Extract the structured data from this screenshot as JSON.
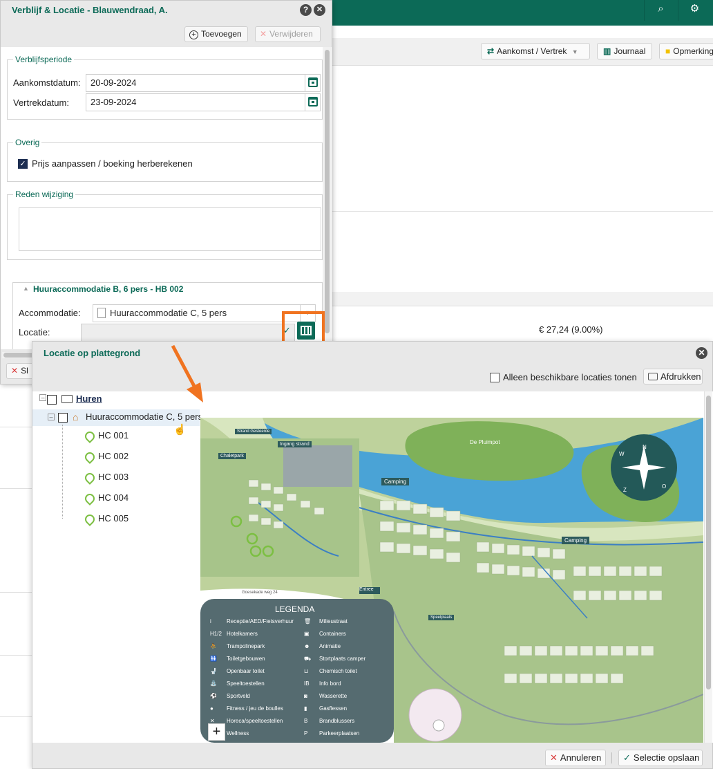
{
  "background": {
    "toolbar_buttons": [
      {
        "label": "Aankomst / Vertrek",
        "icon": "swap-arrows-icon"
      },
      {
        "label": "Journaal",
        "icon": "columns-icon"
      },
      {
        "label": "Opmerking",
        "icon": "comment-icon"
      }
    ],
    "price": "€ 27,24 (9.00%)",
    "close_button_partial": "Sl"
  },
  "dialog1": {
    "title": "Verblijf & Locatie - Blauwendraad, A.",
    "help_icon": "?",
    "add_label": "Toevoegen",
    "remove_label": "Verwijderen",
    "stay": {
      "legend": "Verblijfsperiode",
      "arrival_label": "Aankomstdatum:",
      "arrival_value": "20-09-2024",
      "departure_label": "Vertrekdatum:",
      "departure_value": "23-09-2024"
    },
    "other": {
      "legend": "Overig",
      "checkbox_label": "Prijs aanpassen / boeking herberekenen",
      "checked": true
    },
    "reason": {
      "legend": "Reden wijziging",
      "value": ""
    },
    "group": {
      "title": "Huuraccommodatie B, 6 pers - HB 002",
      "accommodation_label": "Accommodatie:",
      "accommodation_value": "Huuraccommodatie C, 5 pers",
      "location_label": "Locatie:",
      "location_value": ""
    }
  },
  "dialog2": {
    "title": "Locatie op plattegrond",
    "only_available_label": "Alleen beschikbare locaties tonen",
    "print_label": "Afdrukken",
    "tree": {
      "root": "Huren",
      "category": "Huuraccommodatie C, 5 pers",
      "items": [
        "HC 001",
        "HC 002",
        "HC 003",
        "HC 004",
        "HC 005"
      ]
    },
    "map": {
      "labels": {
        "strand": "Strand Gesteerde",
        "ingang_strand": "Ingang strand",
        "chaletpark": "Chaletpark",
        "camping1": "Camping",
        "camping2": "Camping",
        "pluimpot": "De Pluimpot",
        "entree": "Entree",
        "speelplaats": "Speelplaats",
        "road": "Goesekade weg 24"
      },
      "compass": [
        "N",
        "O",
        "Z",
        "W"
      ],
      "legend_title": "LEGENDA",
      "legend_left": [
        {
          "icon": "i",
          "text": "Receptie/AED/Fietsverhuur"
        },
        {
          "icon": "H1/2",
          "text": "Hotelkamers"
        },
        {
          "icon": "⛹",
          "text": "Trampolinepark"
        },
        {
          "icon": "🚻",
          "text": "Toiletgebouwen"
        },
        {
          "icon": "🚽",
          "text": "Openbaar toilet"
        },
        {
          "icon": "⛲",
          "text": "Speeltoestellen"
        },
        {
          "icon": "⚽",
          "text": "Sportveld"
        },
        {
          "icon": "●",
          "text": "Fitness / jeu de boulles"
        },
        {
          "icon": "✕",
          "text": "Horeca/speeltoestellen"
        },
        {
          "icon": "♨",
          "text": "Wellness"
        }
      ],
      "legend_right": [
        {
          "icon": "🗑",
          "text": "Milieustraat"
        },
        {
          "icon": "▣",
          "text": "Containers"
        },
        {
          "icon": "☻",
          "text": "Animatie"
        },
        {
          "icon": "⛟",
          "text": "Stortplaats camper"
        },
        {
          "icon": "⊔",
          "text": "Chemisch toilet"
        },
        {
          "icon": "IB",
          "text": "Info bord"
        },
        {
          "icon": "◙",
          "text": "Wasserette"
        },
        {
          "icon": "▮",
          "text": "Gasflessen"
        },
        {
          "icon": "B",
          "text": "Brandblussers"
        },
        {
          "icon": "P",
          "text": "Parkeerplaatsen"
        }
      ]
    },
    "cancel_label": "Annuleren",
    "save_label": "Selectie opslaan",
    "colors": {
      "accent": "#0c6a57",
      "water": "#4aa3d6",
      "land": "#c7d9a3",
      "legend_bg": "#556b70",
      "highlight": "#f07320",
      "pin": "#7cbf42"
    }
  }
}
